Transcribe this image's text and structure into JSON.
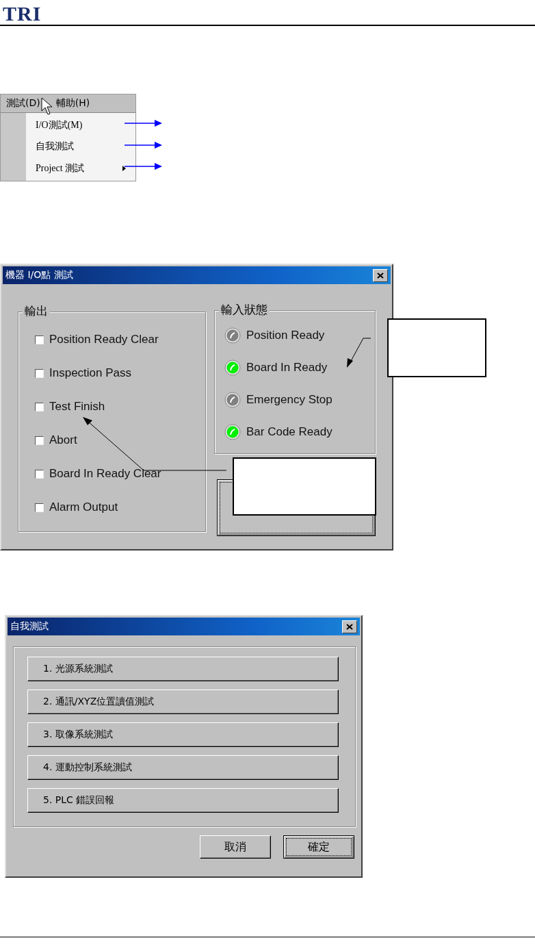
{
  "header": {
    "logo": "TRI"
  },
  "menu": {
    "menubar": [
      {
        "label": "測試(D)",
        "selected": true
      },
      {
        "label": "輔助(H)",
        "selected": false
      }
    ],
    "items": [
      {
        "label": "I/O測試(M)",
        "submenu": false
      },
      {
        "label": "自我測試",
        "submenu": false
      },
      {
        "label": "Project 測試",
        "submenu": true
      }
    ]
  },
  "io_dialog": {
    "title": "機器 I/O點 測試",
    "outputs": {
      "title": "輸出",
      "items": [
        {
          "label": "Position Ready Clear",
          "checked": false
        },
        {
          "label": "Inspection Pass",
          "checked": false
        },
        {
          "label": "Test Finish",
          "checked": false
        },
        {
          "label": "Abort",
          "checked": false
        },
        {
          "label": "Board In Ready Clear",
          "checked": false
        },
        {
          "label": "Alarm Output",
          "checked": false
        }
      ]
    },
    "inputs": {
      "title": "輸入狀態",
      "items": [
        {
          "label": "Position Ready",
          "on": false
        },
        {
          "label": "Board In Ready",
          "on": true
        },
        {
          "label": "Emergency Stop",
          "on": false
        },
        {
          "label": "Bar Code Ready",
          "on": true
        }
      ]
    }
  },
  "self_test_dialog": {
    "title": "自我測試",
    "tests": [
      "1. 光源系統測試",
      "2. 通訊/XYZ位置讀值測試",
      "3. 取像系統測試",
      "4. 運動控制系統測試",
      "5. PLC 錯誤回報"
    ],
    "buttons": [
      {
        "label": "取消",
        "focused": false
      },
      {
        "label": "確定",
        "focused": true
      }
    ]
  }
}
